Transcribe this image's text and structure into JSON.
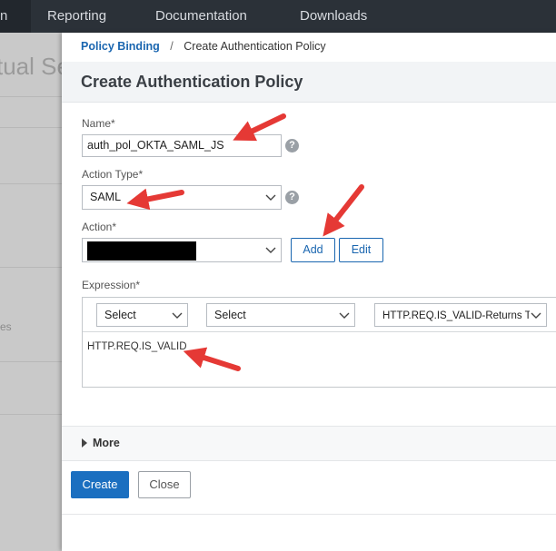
{
  "topnav": {
    "cut_item": "n",
    "items": [
      "Reporting",
      "Documentation",
      "Downloads"
    ]
  },
  "background": {
    "title_fragment": "tual Se",
    "side_text_fragment": "es"
  },
  "breadcrumb": {
    "parent": "Policy Binding",
    "separator": "/",
    "current": "Create Authentication Policy"
  },
  "form": {
    "title": "Create Authentication Policy",
    "name": {
      "label": "Name*",
      "value": "auth_pol_OKTA_SAML_JS"
    },
    "action_type": {
      "label": "Action Type*",
      "value": "SAML"
    },
    "action": {
      "label": "Action*",
      "value": "",
      "add_label": "Add",
      "edit_label": "Edit"
    },
    "expression": {
      "label": "Expression*",
      "select1": "Select",
      "select2": "Select",
      "select3": "HTTP.REQ.IS_VALID-Returns T",
      "text": "HTTP.REQ.IS_VALID"
    },
    "more_label": "More",
    "create_label": "Create",
    "close_label": "Close",
    "help_glyph": "?"
  },
  "colors": {
    "nav_bg": "#2b3138",
    "link_blue": "#1a66b0",
    "primary_button": "#1b6fc0",
    "annotation_arrow": "#e53935"
  },
  "icons": [
    "chevron-down-icon",
    "help-icon",
    "triangle-right-icon",
    "red-arrow-annotation"
  ]
}
